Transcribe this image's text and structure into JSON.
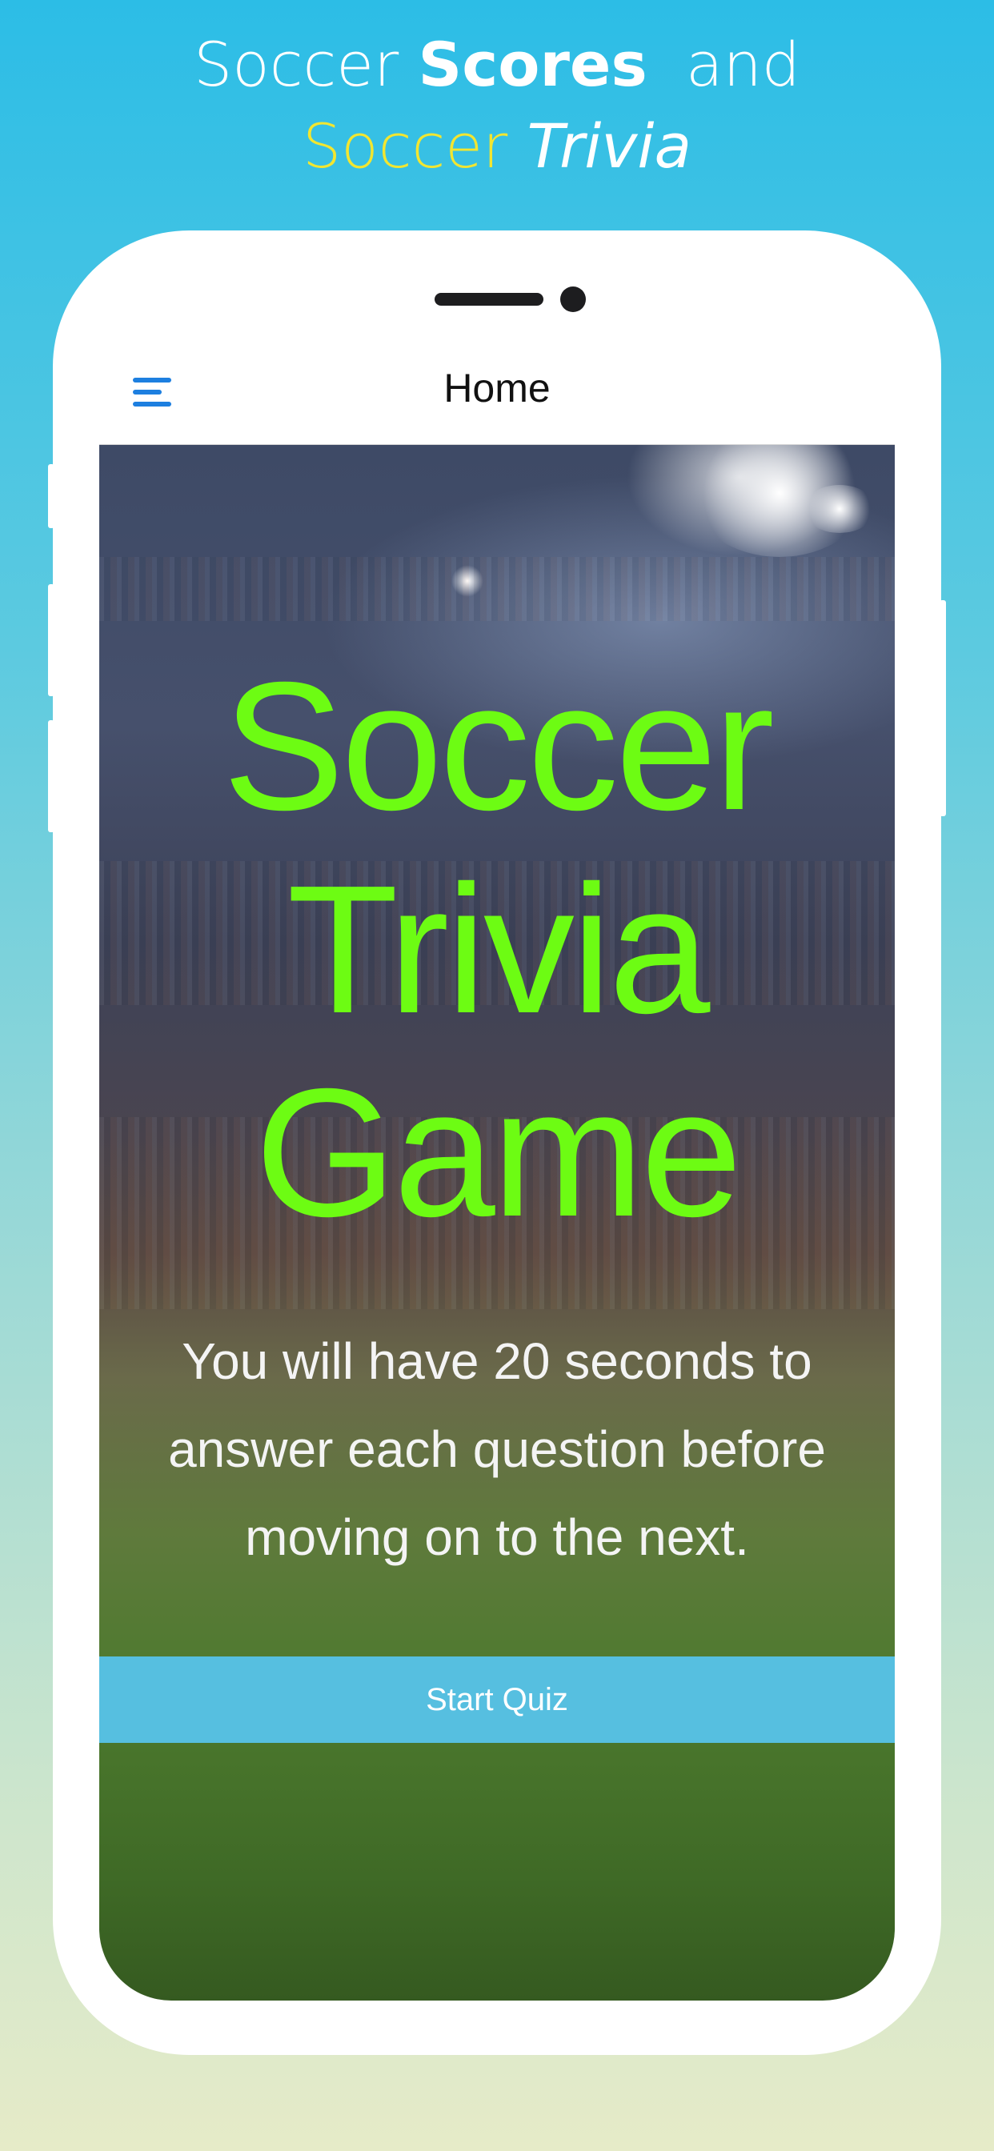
{
  "headline": {
    "line1_a": "Soccer",
    "line1_b": "Scores",
    "line1_c": "and",
    "line2_a": "Soccer",
    "line2_b": "Trivia"
  },
  "navbar": {
    "title": "Home",
    "menu_icon": "hamburger-menu-icon"
  },
  "screen": {
    "title_lines": [
      "Soccer",
      "Trivia",
      "Game"
    ],
    "description": "You will have 20 seconds to answer each question before moving on to the next.",
    "start_button_label": "Start Quiz"
  },
  "colors": {
    "title_green": "#6dfc13",
    "button_blue": "#56bfe0",
    "menu_icon_blue": "#1d7fe0",
    "headline_yellow": "#f2e630"
  }
}
